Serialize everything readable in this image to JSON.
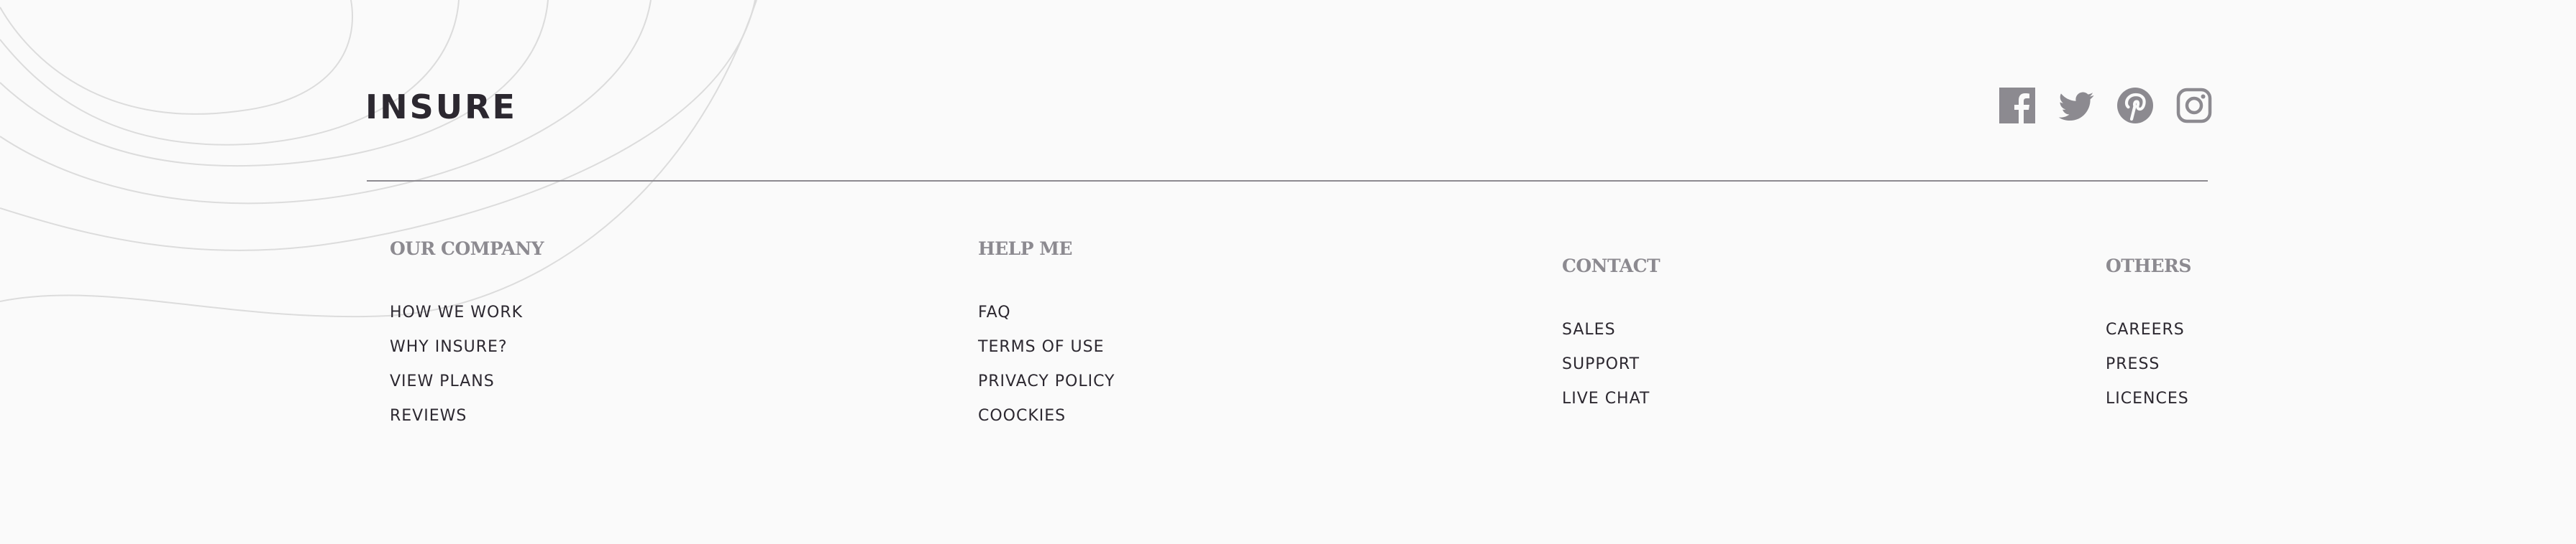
{
  "brand": {
    "logo_text": "INSURE"
  },
  "social": [
    {
      "name": "facebook-icon",
      "color": "#8c8a90"
    },
    {
      "name": "twitter-icon",
      "color": "#8c8a90"
    },
    {
      "name": "pinterest-icon",
      "color": "#8c8a90"
    },
    {
      "name": "instagram-icon",
      "color": "#8c8a90"
    }
  ],
  "footer": {
    "columns": [
      {
        "heading": "OUR COMPANY",
        "links": [
          "HOW WE WORK",
          "WHY INSURE?",
          "VIEW PLANS",
          "REVIEWS"
        ]
      },
      {
        "heading": "HELP ME",
        "links": [
          "FAQ",
          "TERMS OF USE",
          "PRIVACY POLICY",
          "COOCKIES"
        ]
      },
      {
        "heading": "CONTACT",
        "links": [
          "SALES",
          "SUPPORT",
          "LIVE CHAT"
        ]
      },
      {
        "heading": "OTHERS",
        "links": [
          "CAREERS",
          "PRESS",
          "LICENCES"
        ]
      }
    ]
  },
  "colors": {
    "background": "#fafafa",
    "text_dark": "#2c2830",
    "text_muted": "#8c8a90",
    "pattern_line": "#dcdcdc"
  }
}
